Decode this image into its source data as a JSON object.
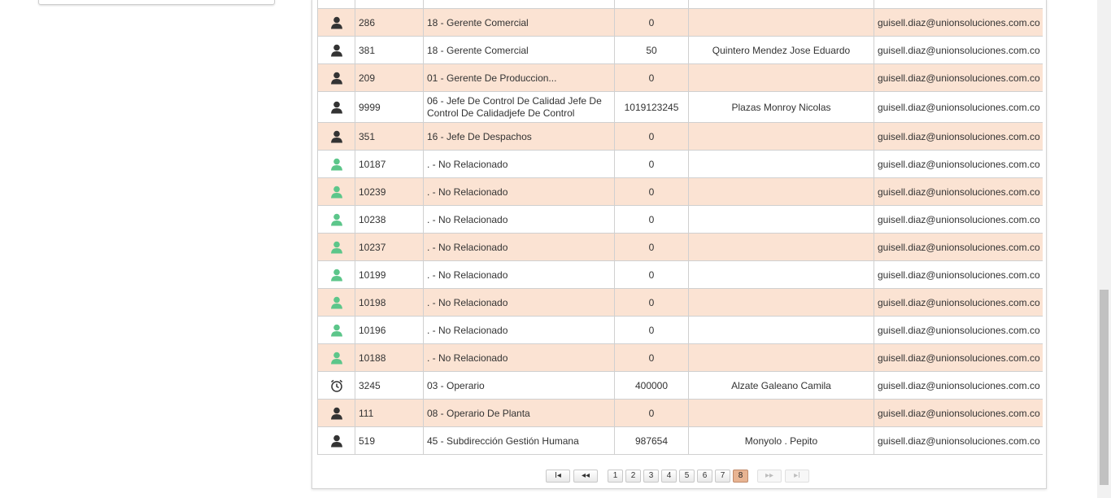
{
  "colors": {
    "row_odd": "#fbe3d3",
    "row_even": "#ffffff",
    "user_dark": "#333333",
    "user_green": "#5cc68a",
    "pager_active": "#e8b492"
  },
  "rows": [
    {
      "icon": "user-dark-icon",
      "id": "286",
      "cargo": "18 - Gerente Comercial",
      "numero": "0",
      "nombre": "",
      "email": "guisell.diaz@unionsoluciones.com.co"
    },
    {
      "icon": "user-dark-icon",
      "id": "381",
      "cargo": "18 - Gerente Comercial",
      "numero": "50",
      "nombre": "Quintero Mendez Jose Eduardo",
      "email": "guisell.diaz@unionsoluciones.com.co"
    },
    {
      "icon": "user-dark-icon",
      "id": "209",
      "cargo": "01 - Gerente De Produccion...",
      "numero": "0",
      "nombre": "",
      "email": "guisell.diaz@unionsoluciones.com.co"
    },
    {
      "icon": "user-dark-icon",
      "id": "9999",
      "cargo": "06 - Jefe De Control De Calidad Jefe De Control De Calidadjefe De Control",
      "numero": "1019123245",
      "nombre": "Plazas Monroy Nicolas",
      "email": "guisell.diaz@unionsoluciones.com.co"
    },
    {
      "icon": "user-dark-icon",
      "id": "351",
      "cargo": "16 - Jefe De Despachos",
      "numero": "0",
      "nombre": "",
      "email": "guisell.diaz@unionsoluciones.com.co"
    },
    {
      "icon": "user-green-icon",
      "id": "10187",
      "cargo": ". - No Relacionado",
      "numero": "0",
      "nombre": "",
      "email": "guisell.diaz@unionsoluciones.com.co"
    },
    {
      "icon": "user-green-icon",
      "id": "10239",
      "cargo": ". - No Relacionado",
      "numero": "0",
      "nombre": "",
      "email": "guisell.diaz@unionsoluciones.com.co"
    },
    {
      "icon": "user-green-icon",
      "id": "10238",
      "cargo": ". - No Relacionado",
      "numero": "0",
      "nombre": "",
      "email": "guisell.diaz@unionsoluciones.com.co"
    },
    {
      "icon": "user-green-icon",
      "id": "10237",
      "cargo": ". - No Relacionado",
      "numero": "0",
      "nombre": "",
      "email": "guisell.diaz@unionsoluciones.com.co"
    },
    {
      "icon": "user-green-icon",
      "id": "10199",
      "cargo": ". - No Relacionado",
      "numero": "0",
      "nombre": "",
      "email": "guisell.diaz@unionsoluciones.com.co"
    },
    {
      "icon": "user-green-icon",
      "id": "10198",
      "cargo": ". - No Relacionado",
      "numero": "0",
      "nombre": "",
      "email": "guisell.diaz@unionsoluciones.com.co"
    },
    {
      "icon": "user-green-icon",
      "id": "10196",
      "cargo": ". - No Relacionado",
      "numero": "0",
      "nombre": "",
      "email": "guisell.diaz@unionsoluciones.com.co"
    },
    {
      "icon": "user-green-icon",
      "id": "10188",
      "cargo": ". - No Relacionado",
      "numero": "0",
      "nombre": "",
      "email": "guisell.diaz@unionsoluciones.com.co"
    },
    {
      "icon": "alarm-clock-icon",
      "id": "3245",
      "cargo": "03 - Operario",
      "numero": "400000",
      "nombre": "Alzate Galeano Camila",
      "email": "guisell.diaz@unionsoluciones.com.co"
    },
    {
      "icon": "user-dark-icon",
      "id": "111",
      "cargo": "08 - Operario De Planta",
      "numero": "0",
      "nombre": "",
      "email": "guisell.diaz@unionsoluciones.com.co"
    },
    {
      "icon": "user-dark-icon",
      "id": "519",
      "cargo": "45 - Subdirección Gestión Humana",
      "numero": "987654",
      "nombre": "Monyolo . Pepito",
      "email": "guisell.diaz@unionsoluciones.com.co"
    }
  ],
  "pager": {
    "first": "I◂",
    "prev": "◂◂",
    "pages": [
      "1",
      "2",
      "3",
      "4",
      "5",
      "6",
      "7",
      "8"
    ],
    "current": "8",
    "next": "▸▸",
    "last": "▸I"
  }
}
